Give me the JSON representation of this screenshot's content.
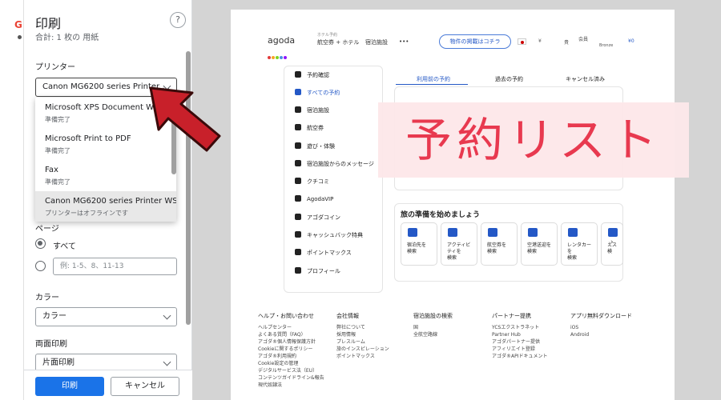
{
  "dialog": {
    "title": "印刷",
    "subtitle": "合計: 1 枚の 用紙",
    "help_label": "?",
    "printer_label": "プリンター",
    "printer_selected": "Canon MG6200 series Printer ...",
    "printers": [
      {
        "name": "Microsoft XPS Document Writer",
        "status": "準備完了"
      },
      {
        "name": "Microsoft Print to PDF",
        "status": "準備完了"
      },
      {
        "name": "Fax",
        "status": "準備完了"
      },
      {
        "name": "Canon MG6200 series Printer WS",
        "status": "プリンターはオフラインです"
      }
    ],
    "pages_label": "ページ",
    "pages_all": "すべて",
    "pages_custom_placeholder": "例: 1-5、8、11-13",
    "color_label": "カラー",
    "color_value": "カラー",
    "duplex_label": "両面印刷",
    "duplex_value": "片面印刷",
    "print_button": "印刷",
    "cancel_button": "キャンセル"
  },
  "preview": {
    "logo": "agoda",
    "logo_colors": [
      "#e23b3b",
      "#f5a623",
      "#7ed321",
      "#4a90e2",
      "#9013fe"
    ],
    "nav_mini": "ホテル予約",
    "nav": [
      "航空券 + ホテル",
      "宿泊施設",
      "•••"
    ],
    "cta": "物件の掲載はコチラ",
    "currency": "¥",
    "header_user": "貴",
    "header_member": "会員",
    "header_rank": "Bronze",
    "header_points": "¥0",
    "sidebar": [
      {
        "label": "予約確認",
        "icon": "calendar-icon"
      },
      {
        "label": "すべての予約",
        "icon": "suitcase-icon"
      },
      {
        "label": "宿泊施設",
        "icon": "building-icon"
      },
      {
        "label": "航空券",
        "icon": "plane-icon"
      },
      {
        "label": "遊び・体験",
        "icon": "ferris-wheel-icon"
      },
      {
        "label": "宿泊施設からのメッセージ",
        "icon": "message-icon"
      },
      {
        "label": "クチコミ",
        "icon": "star-icon"
      },
      {
        "label": "AgodaVIP",
        "icon": "vip-icon"
      },
      {
        "label": "アゴダコイン",
        "icon": "coin-icon"
      },
      {
        "label": "キャッシュバック特典",
        "icon": "cashback-icon"
      },
      {
        "label": "ポイントマックス",
        "icon": "pointsmax-icon"
      },
      {
        "label": "プロフィール",
        "icon": "profile-icon"
      }
    ],
    "tabs": [
      "利用前の予約",
      "過去の予約",
      "キャンセル済み"
    ],
    "trip_title": "旅の準備を始めましょう",
    "tiles": [
      {
        "label": "宿泊先を\n検索",
        "icon": "hotel-icon"
      },
      {
        "label": "アクティビ\nティを\n検索",
        "icon": "activity-icon"
      },
      {
        "label": "航空券を\n検索",
        "icon": "flight-icon"
      },
      {
        "label": "空港送迎を\n検索",
        "icon": "transfer-icon"
      },
      {
        "label": "レンタカー\nを\n検索",
        "icon": "car-icon"
      },
      {
        "label": "えス\n検",
        "icon": "bus-icon"
      }
    ],
    "next": "›",
    "footer": [
      {
        "heading": "ヘルプ・お問い合わせ",
        "links": [
          "ヘルプセンター",
          "よくある質問（FAQ）",
          "アゴダ®個人情報保護方針",
          "Cookieに関するポリシー",
          "アゴダ®利用規約",
          "Cookie設定の管理",
          "デジタルサービス法（EU）",
          "コンテンツガイドライン&報告",
          "現代奴隷法"
        ]
      },
      {
        "heading": "会社情報",
        "links": [
          "弊社について",
          "採用情報",
          "プレスルーム",
          "旅のインスピレーション",
          "ポイントマックス"
        ]
      },
      {
        "heading": "宿泊施設の検索",
        "links": [
          "国",
          "全航空路線"
        ]
      },
      {
        "heading": "パートナー提携",
        "links": [
          "YCSエクストラネット",
          "Partner Hub",
          "アゴダパートナー提供",
          "アフィリエイト登録",
          "アゴダ®APIドキュメント"
        ]
      },
      {
        "heading": "アプリ無料ダウンロード",
        "links": [
          "iOS",
          "Android"
        ]
      }
    ]
  },
  "overlay_text": "予約リスト",
  "accent_color": "#1a73e8",
  "arrow_color": "#c8202a"
}
